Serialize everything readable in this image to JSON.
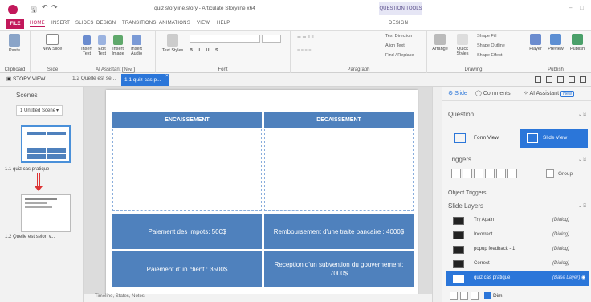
{
  "window": {
    "title": "quiz storyline.story - Articulate Storyline x64",
    "context_tab_group": "QUESTION TOOLS",
    "qat_icons": [
      "save-icon",
      "undo-icon",
      "redo-icon"
    ],
    "minimize": "–",
    "restore": "□"
  },
  "ribbon_tabs": [
    "FILE",
    "HOME",
    "INSERT",
    "SLIDES",
    "DESIGN",
    "TRANSITIONS",
    "ANIMATIONS",
    "VIEW",
    "HELP",
    "DESIGN"
  ],
  "ribbon": {
    "clipboard": {
      "paste": "Paste",
      "label": "Clipboard"
    },
    "slide": {
      "new_slide": "New Slide",
      "label": "Slide"
    },
    "ai": {
      "insert_text": "Insert Text",
      "edit_text": "Edit Text",
      "insert_image": "Insert Image",
      "insert_audio": "Insert Audio",
      "label": "AI Assistant",
      "badge": "New"
    },
    "font": {
      "text_styles": "Text Styles",
      "label": "Font"
    },
    "paragraph": {
      "text_direction": "Text Direction",
      "align_text": "Align Text",
      "find_replace": "Find / Replace",
      "label": "Paragraph"
    },
    "drawing": {
      "arrange": "Arrange",
      "quick_styles": "Quick Styles",
      "shape_fill": "Shape Fill",
      "shape_outline": "Shape Outline",
      "shape_effect": "Shape Effect",
      "label": "Drawing"
    },
    "publish": {
      "player": "Player",
      "preview": "Preview",
      "publish": "Publish",
      "label": "Publish"
    }
  },
  "doc_tabs": {
    "story_view": "STORY VIEW",
    "tab1": "1.2 Quelle est se...",
    "tab2": "1.1 quiz cas p...",
    "close": "×"
  },
  "scenes": {
    "title": "Scenes",
    "scene_select": "1 Untitled Scene",
    "slides": [
      {
        "label": "1.1 quiz cas pratique"
      },
      {
        "label": "1.2 Quelle est selon v..."
      }
    ]
  },
  "slide": {
    "headers": [
      "ENCAISSEMENT",
      "DECAISSEMENT"
    ],
    "cards": [
      "Paiement des impots: 500$",
      "Remboursement d'une traite bancaire : 4000$",
      "Paiement d'un client : 3500$",
      "Reception d'un subvention du gouvernement: 7000$"
    ],
    "colors": {
      "header": "#4f81bd",
      "card": "#4f81bd"
    }
  },
  "timeline_bar": "Timeline, States, Notes",
  "right_panel": {
    "tabs": {
      "slide": "Slide",
      "comments": "Comments",
      "ai": "AI Assistant",
      "ai_badge": "New"
    },
    "question": {
      "title": "Question",
      "form_view": "Form View",
      "slide_view": "Slide View"
    },
    "triggers": {
      "title": "Triggers",
      "group": "Group"
    },
    "object_triggers": "Object Triggers",
    "slide_layers": {
      "title": "Slide Layers",
      "layers": [
        {
          "name": "Try Again",
          "type": "(Dialog)"
        },
        {
          "name": "Incorrect",
          "type": "(Dialog)"
        },
        {
          "name": "popup feedback - 1",
          "type": "(Dialog)"
        },
        {
          "name": "Correct",
          "type": "(Dialog)"
        },
        {
          "name": "quiz cas pratique",
          "type": "(Base Layer)"
        }
      ]
    },
    "dim_label": "Dim"
  },
  "accent_color": "#2b76d9",
  "brand_color": "#c2185b"
}
